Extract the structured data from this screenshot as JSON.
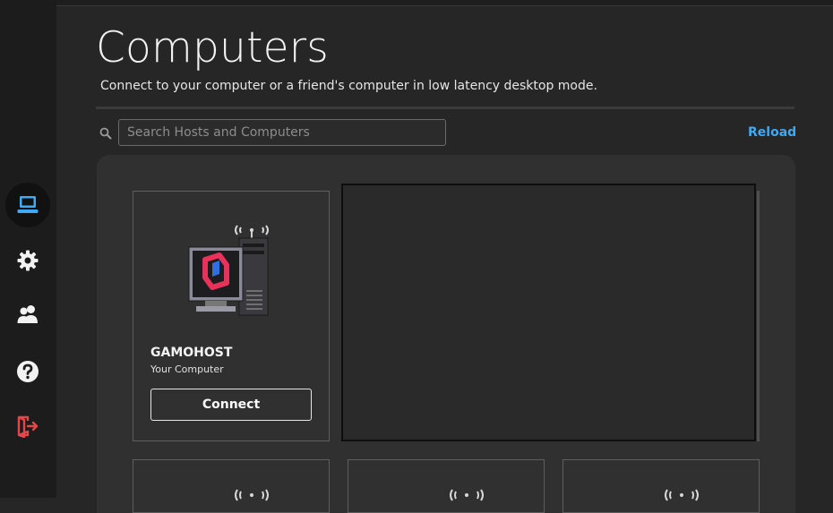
{
  "sidebar": {
    "items": [
      {
        "name": "computers",
        "icon": "laptop-icon",
        "active": true
      },
      {
        "name": "settings",
        "icon": "gear-icon",
        "active": false
      },
      {
        "name": "friends",
        "icon": "users-icon",
        "active": false
      },
      {
        "name": "help",
        "icon": "help-icon",
        "active": false
      },
      {
        "name": "logout",
        "icon": "logout-icon",
        "active": false
      }
    ],
    "colors": {
      "active_icon": "#3fa9f5",
      "icon": "#f2f2f2",
      "logout_icon": "#e24848"
    }
  },
  "header": {
    "title": "Computers",
    "subtitle": "Connect to your computer or a friend's computer in low latency desktop mode."
  },
  "search": {
    "placeholder": "Search Hosts and Computers",
    "value": ""
  },
  "actions": {
    "reload_label": "Reload"
  },
  "hosts": [
    {
      "name": "GAMOHOST",
      "subtitle": "Your Computer",
      "button_label": "Connect"
    }
  ],
  "colors": {
    "accent": "#3fa9f5",
    "logo_pink": "#e8325a",
    "logo_blue": "#2f6fe0"
  }
}
